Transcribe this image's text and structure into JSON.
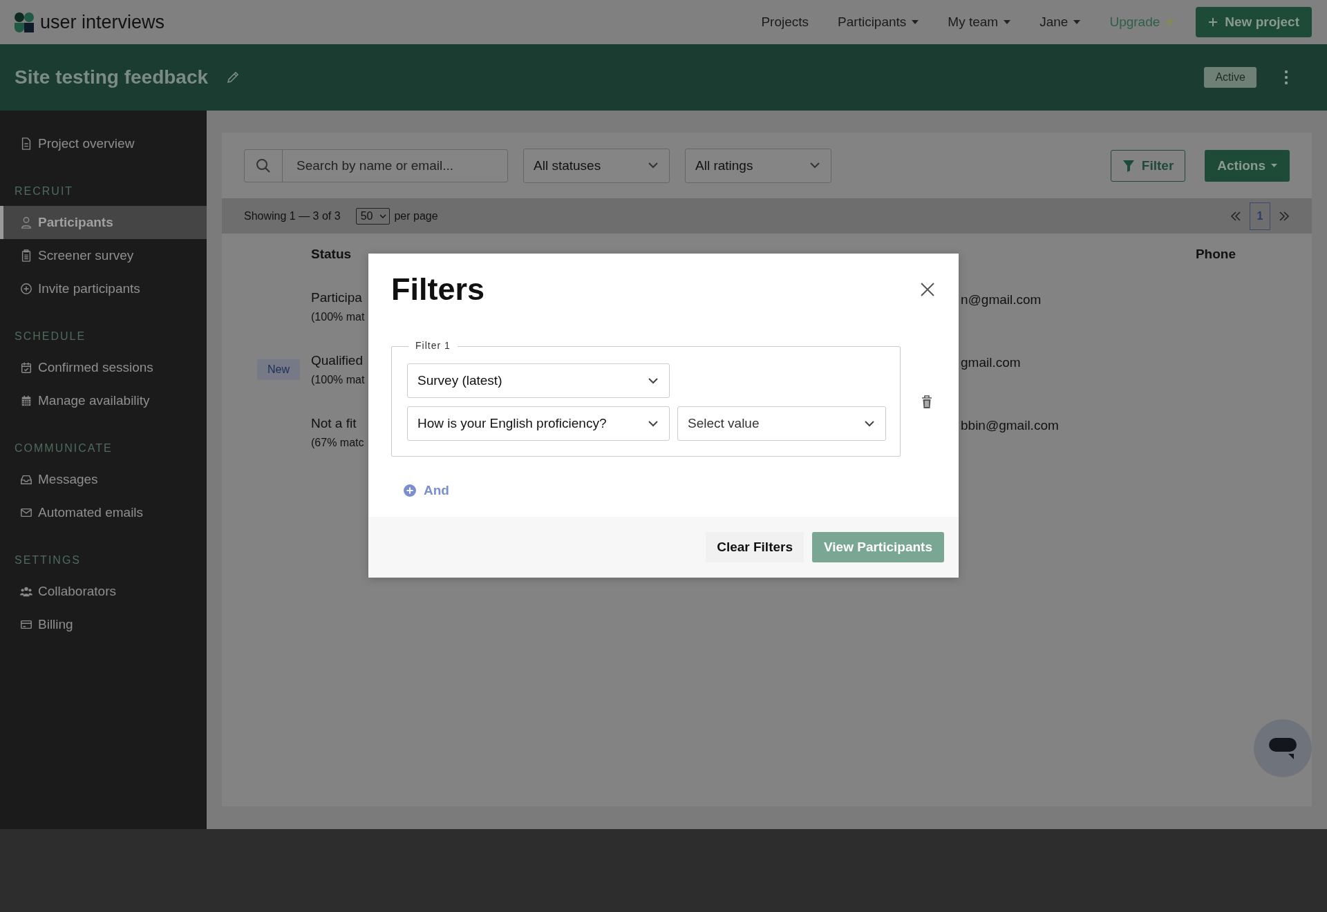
{
  "top_nav": {
    "logo_text": "user interviews",
    "links": [
      {
        "label": "Projects",
        "dropdown": false
      },
      {
        "label": "Participants",
        "dropdown": true
      },
      {
        "label": "My team",
        "dropdown": true
      },
      {
        "label": "Jane",
        "dropdown": true
      }
    ],
    "upgrade": "Upgrade",
    "new_project_button": "New project"
  },
  "project_header": {
    "title": "Site testing feedback",
    "status_badge": "Active"
  },
  "sidebar": {
    "items": [
      {
        "kind": "item",
        "label": "Project overview",
        "selected": false
      },
      {
        "kind": "heading",
        "label": "RECRUIT"
      },
      {
        "kind": "item",
        "label": "Participants",
        "selected": true
      },
      {
        "kind": "item",
        "label": "Screener survey",
        "selected": false
      },
      {
        "kind": "item",
        "label": "Invite participants",
        "selected": false
      },
      {
        "kind": "heading",
        "label": "SCHEDULE"
      },
      {
        "kind": "item",
        "label": "Confirmed sessions",
        "selected": false
      },
      {
        "kind": "item",
        "label": "Manage availability",
        "selected": false
      },
      {
        "kind": "heading",
        "label": "COMMUNICATE"
      },
      {
        "kind": "item",
        "label": "Messages",
        "selected": false
      },
      {
        "kind": "item",
        "label": "Automated emails",
        "selected": false
      },
      {
        "kind": "heading",
        "label": "SETTINGS"
      },
      {
        "kind": "item",
        "label": "Collaborators",
        "selected": false
      },
      {
        "kind": "item",
        "label": "Billing",
        "selected": false
      }
    ]
  },
  "toolbar": {
    "search": {
      "placeholder": "Search by name or email..."
    },
    "status_select": "All statuses",
    "rating_select": "All ratings",
    "filter_button": "Filter",
    "actions_button": "Actions"
  },
  "pagination": {
    "summary": "Showing 1 — 3 of 3",
    "per_page": "50",
    "per_page_label": "per page",
    "pages": [
      {
        "label": "1",
        "selected": true
      }
    ]
  },
  "table": {
    "columns": [
      {
        "label": "Status"
      },
      {
        "label": "Phone"
      }
    ],
    "rows": [
      {
        "status": "Participa",
        "match": "(100% mat",
        "email": "n@gmail.com"
      },
      {
        "badge": "New",
        "status": "Qualified",
        "match": "(100% mat",
        "email": "gmail.com"
      },
      {
        "status": "Not a fit",
        "match": "(67% matc",
        "email": "bbin@gmail.com"
      }
    ]
  },
  "filters_modal": {
    "title": "Filters",
    "groups": [
      {
        "legend": "Filter 1",
        "selects": [
          {
            "value": "Survey (latest)"
          },
          {
            "value": "How is your English proficiency?"
          },
          {
            "placeholder": "Select value"
          }
        ]
      }
    ],
    "add_button": "And",
    "clear_button": "Clear Filters",
    "submit_button": {
      "label": "View Participants",
      "disabled": true
    }
  }
}
